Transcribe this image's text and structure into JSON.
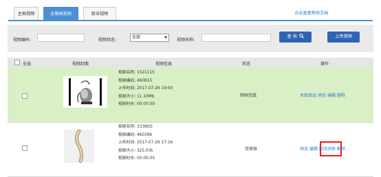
{
  "tabs": [
    {
      "label": "主图视频"
    },
    {
      "label": "全景图视频"
    },
    {
      "label": "商详视频"
    }
  ],
  "help_link": "点击查看帮助文档",
  "filter": {
    "code_label": "视频编码:",
    "status_label": "视频状态:",
    "status_value": "全部",
    "name_label": "视频名称:",
    "search_button": "查 询",
    "upload_button": "上传视频"
  },
  "table": {
    "headers": {
      "select_all": "全选",
      "cover": "视频封面",
      "info": "视频信息",
      "status": "状态",
      "actions": "操作"
    },
    "rows": [
      {
        "name": "视频名称: 1521115",
        "code": "视频编码: 460815",
        "upload_time": "上传时间: 2017-07-26 19:00",
        "size": "视频大小: 11.10Mb",
        "duration": "视频时长: 00:00:09",
        "status": "转码完成",
        "actions": [
          "关联商品",
          "预览",
          "编辑",
          "删除"
        ]
      },
      {
        "name": "视频名称: 333NSS",
        "code": "视频编码: 460396",
        "upload_time": "上传时间: 2017-07-26 17:16",
        "size": "视频大小: 325.03k",
        "duration": "视频时长: 00:00:05",
        "status": "待审核",
        "actions": [
          "预览",
          "编辑",
          "取消关联",
          "删除"
        ]
      }
    ]
  },
  "colors": {
    "accent": "#4a8ed3",
    "button": "#2f64b5",
    "link": "#2f7fd1",
    "row_highlight": "#d9efc5",
    "annotation": "#dd2222"
  }
}
